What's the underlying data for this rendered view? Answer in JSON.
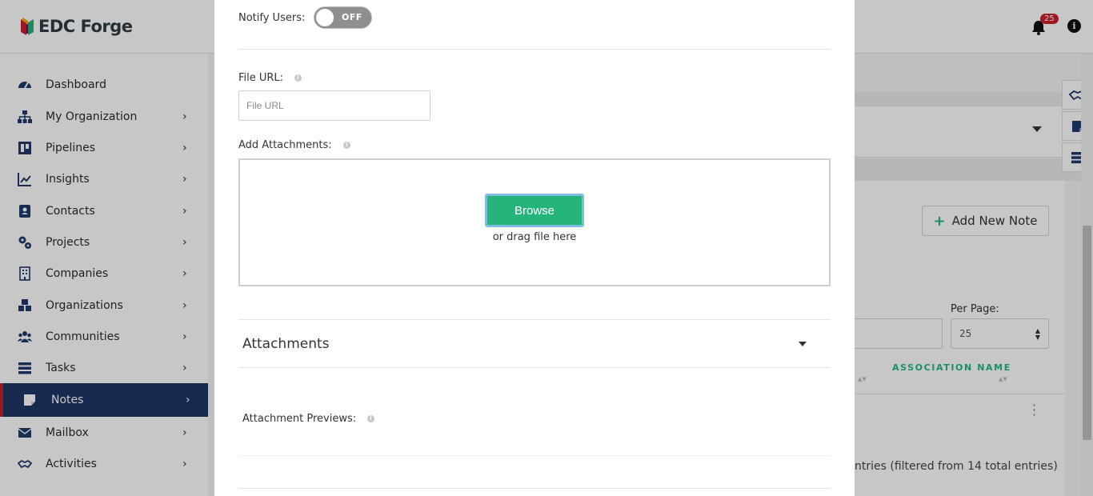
{
  "app": {
    "brand": "EDC Forge",
    "notification_count": "25"
  },
  "sidebar": {
    "items": [
      {
        "label": "Dashboard",
        "icon": "dashboard-icon",
        "chevron": ""
      },
      {
        "label": "My Organization",
        "icon": "org-chart-icon",
        "chevron": "›"
      },
      {
        "label": "Pipelines",
        "icon": "pipeline-icon",
        "chevron": "›"
      },
      {
        "label": "Insights",
        "icon": "line-chart-icon",
        "chevron": "›"
      },
      {
        "label": "Contacts",
        "icon": "contact-card-icon",
        "chevron": "›"
      },
      {
        "label": "Projects",
        "icon": "gears-icon",
        "chevron": "›"
      },
      {
        "label": "Companies",
        "icon": "building-icon",
        "chevron": "›"
      },
      {
        "label": "Organizations",
        "icon": "cubes-icon",
        "chevron": "›"
      },
      {
        "label": "Communities",
        "icon": "users-icon",
        "chevron": "›"
      },
      {
        "label": "Tasks",
        "icon": "tasks-icon",
        "chevron": "›"
      },
      {
        "label": "Notes",
        "icon": "sticky-note-icon",
        "chevron": "›"
      },
      {
        "label": "Mailbox",
        "icon": "envelope-icon",
        "chevron": "›"
      },
      {
        "label": "Activities",
        "icon": "handshake-icon",
        "chevron": "›"
      }
    ],
    "active": "Notes"
  },
  "background": {
    "add_note_label": "Add New Note",
    "per_page_label": "Per Page:",
    "per_page_value": "25",
    "column_header": "ASSOCIATION NAME",
    "entries_text": "ntries (filtered from 14 total entries)"
  },
  "modal": {
    "notify_label": "Notify Users:",
    "notify_state": "OFF",
    "file_url_label": "File URL:",
    "file_url_placeholder": "File URL",
    "file_url_value": "",
    "add_attachments_label": "Add Attachments:",
    "browse_label": "Browse",
    "drag_text": "or drag file here",
    "attachments_title": "Attachments",
    "previews_label": "Attachment Previews:"
  },
  "colors": {
    "brand_navy": "#1d3566",
    "accent_green": "#25b47a",
    "active_marker": "#c8202f",
    "badge": "#c8202f"
  }
}
